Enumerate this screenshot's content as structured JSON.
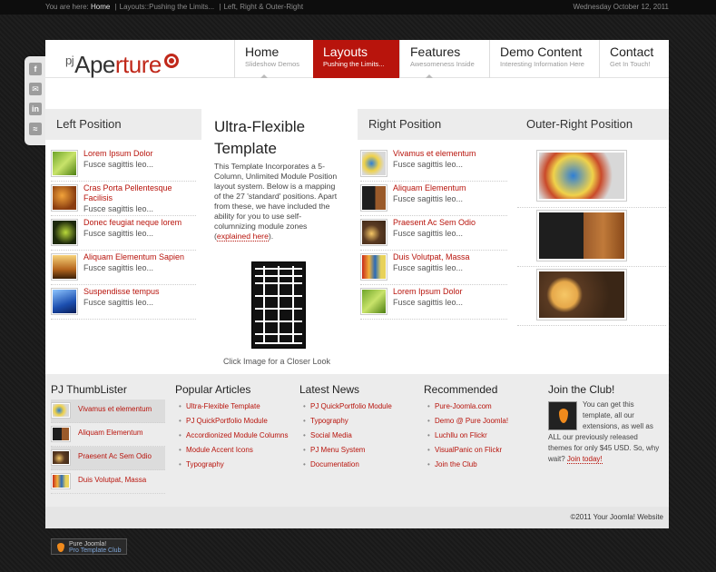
{
  "topbar": {
    "you_are_here": "You are here:",
    "crumb_home": "Home",
    "crumb_sep": "|",
    "crumb_2": "Layouts::Pushing the Limits...",
    "crumb_3": "Left, Right & Outer-Right",
    "date": "Wednesday October 12, 2011"
  },
  "social": {
    "icons": [
      "facebook-icon",
      "email-icon",
      "linkedin-icon",
      "rss-icon"
    ]
  },
  "logo": {
    "prefix": "pj",
    "main": "Ape",
    "accent": "rture"
  },
  "nav": [
    {
      "title": "Home",
      "desc": "Slideshow Demos"
    },
    {
      "title": "Layouts",
      "desc": "Pushing the Limits..."
    },
    {
      "title": "Features",
      "desc": "Awesomeness Inside"
    },
    {
      "title": "Demo Content",
      "desc": "Interesting Information Here"
    },
    {
      "title": "Contact",
      "desc": "Get In Touch!"
    }
  ],
  "left": {
    "heading": "Left Position",
    "items": [
      {
        "title": "Lorem Ipsum Dolor",
        "sub": "Fusce sagittis leo..."
      },
      {
        "title": "Cras Porta Pellentesque Facilisis",
        "sub": "Fusce sagittis leo..."
      },
      {
        "title": "Donec feugiat neque lorem",
        "sub": "Fusce sagittis leo..."
      },
      {
        "title": "Aliquam Elementum Sapien",
        "sub": "Fusce sagittis leo..."
      },
      {
        "title": "Suspendisse tempus",
        "sub": "Fusce sagittis leo..."
      }
    ]
  },
  "center": {
    "title": "Ultra-Flexible Template",
    "body": "This Template Incorporates a 5-Column, Unlimited Module Position layout system. Below is a mapping of the 27 'standard' positions. Apart from these, we have included the ability for you to use self-columnizing module zones (",
    "link": "explained here",
    "end": ").",
    "caption": "Click Image for a Closer Look"
  },
  "right": {
    "heading": "Right Position",
    "items": [
      {
        "title": "Vivamus et elementum",
        "sub": "Fusce sagittis leo..."
      },
      {
        "title": "Aliquam Elementum",
        "sub": "Fusce sagittis leo..."
      },
      {
        "title": "Praesent Ac Sem Odio",
        "sub": "Fusce sagittis leo..."
      },
      {
        "title": "Duis Volutpat, Massa",
        "sub": "Fusce sagittis leo..."
      },
      {
        "title": "Lorem Ipsum Dolor",
        "sub": "Fusce sagittis leo..."
      }
    ]
  },
  "outer_right": {
    "heading": "Outer-Right Position"
  },
  "thumblister": {
    "heading": "PJ ThumbLister",
    "items": [
      "Vivamus et elementum",
      "Aliquam Elementum",
      "Praesent Ac Sem Odio",
      "Duis Volutpat, Massa"
    ]
  },
  "popular": {
    "heading": "Popular Articles",
    "items": [
      "Ultra-Flexible Template",
      "PJ QuickPortfolio Module",
      "Accordionized Module Columns",
      "Module Accent Icons",
      "Typography"
    ]
  },
  "latest": {
    "heading": "Latest News",
    "items": [
      "PJ QuickPortfolio Module",
      "Typography",
      "Social Media",
      "PJ Menu System",
      "Documentation"
    ]
  },
  "recommended": {
    "heading": "Recommended",
    "items": [
      "Pure-Joomla.com",
      "Demo @ Pure Joomla!",
      "Luchllu on Flickr",
      "VisualPanic on Flickr",
      "Join the Club"
    ]
  },
  "club": {
    "heading": "Join the Club!",
    "text": "You can get this template, all our extensions, as well as ALL our previously released themes for only $45 USD. So, why wait?",
    "link": "Join today!"
  },
  "footer": {
    "copyright": "©2011 Your Joomla! Website"
  },
  "badge": {
    "line1": "Pure Joomla!",
    "line2": "Pro Template Club"
  },
  "colors": {
    "accent": "#b8140c",
    "panel": "#ececec",
    "background": "#1c1c1c"
  }
}
